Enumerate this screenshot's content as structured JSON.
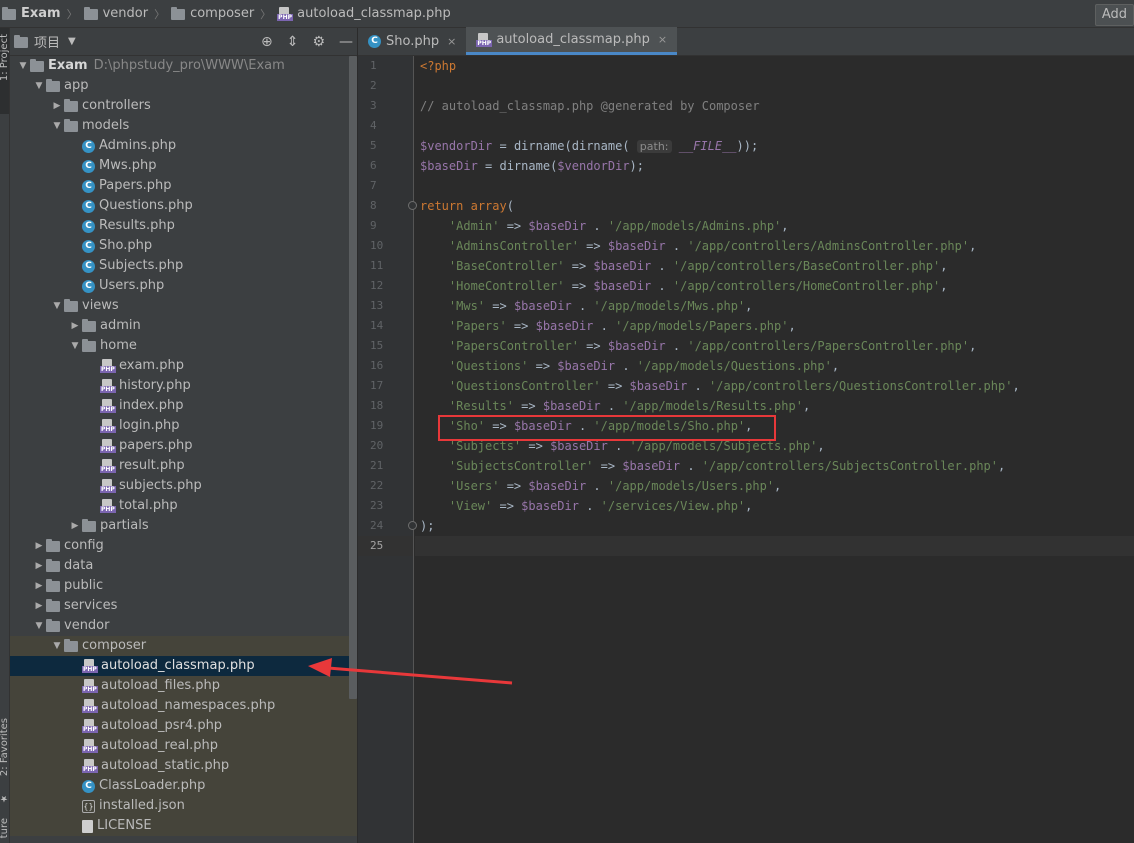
{
  "breadcrumb": {
    "project": "Exam",
    "items": [
      "vendor",
      "composer"
    ],
    "file": "autoload_classmap.php",
    "add_label": "Add"
  },
  "stripe": {
    "project_label": "1: Project",
    "favorites_label": "2: Favorites",
    "structure_label": "ture"
  },
  "project_panel": {
    "title": "项目",
    "root_name": "Exam",
    "root_path": "D:\\phpstudy_pro\\WWW\\Exam",
    "tree": [
      {
        "label": "app",
        "type": "folder"
      },
      {
        "label": "controllers",
        "type": "folder"
      },
      {
        "label": "models",
        "type": "folder"
      },
      {
        "label": "Admins.php",
        "type": "class"
      },
      {
        "label": "Mws.php",
        "type": "class"
      },
      {
        "label": "Papers.php",
        "type": "class"
      },
      {
        "label": "Questions.php",
        "type": "class"
      },
      {
        "label": "Results.php",
        "type": "class"
      },
      {
        "label": "Sho.php",
        "type": "class"
      },
      {
        "label": "Subjects.php",
        "type": "class"
      },
      {
        "label": "Users.php",
        "type": "class"
      },
      {
        "label": "views",
        "type": "folder"
      },
      {
        "label": "admin",
        "type": "folder"
      },
      {
        "label": "home",
        "type": "folder"
      },
      {
        "label": "exam.php",
        "type": "php"
      },
      {
        "label": "history.php",
        "type": "php"
      },
      {
        "label": "index.php",
        "type": "php"
      },
      {
        "label": "login.php",
        "type": "php"
      },
      {
        "label": "papers.php",
        "type": "php"
      },
      {
        "label": "result.php",
        "type": "php"
      },
      {
        "label": "subjects.php",
        "type": "php"
      },
      {
        "label": "total.php",
        "type": "php"
      },
      {
        "label": "partials",
        "type": "folder"
      },
      {
        "label": "config",
        "type": "folder"
      },
      {
        "label": "data",
        "type": "folder"
      },
      {
        "label": "public",
        "type": "folder"
      },
      {
        "label": "services",
        "type": "folder"
      },
      {
        "label": "vendor",
        "type": "folder"
      },
      {
        "label": "composer",
        "type": "folder"
      },
      {
        "label": "autoload_classmap.php",
        "type": "php"
      },
      {
        "label": "autoload_files.php",
        "type": "php"
      },
      {
        "label": "autoload_namespaces.php",
        "type": "php"
      },
      {
        "label": "autoload_psr4.php",
        "type": "php"
      },
      {
        "label": "autoload_real.php",
        "type": "php"
      },
      {
        "label": "autoload_static.php",
        "type": "php"
      },
      {
        "label": "ClassLoader.php",
        "type": "class"
      },
      {
        "label": "installed.json",
        "type": "json"
      },
      {
        "label": "LICENSE",
        "type": "text"
      }
    ]
  },
  "tabs": [
    {
      "label": "Sho.php",
      "active": false
    },
    {
      "label": "autoload_classmap.php",
      "active": true
    }
  ],
  "code": {
    "line_numbers": [
      "1",
      "2",
      "3",
      "4",
      "5",
      "6",
      "7",
      "8",
      "9",
      "10",
      "11",
      "12",
      "13",
      "14",
      "15",
      "16",
      "17",
      "18",
      "19",
      "20",
      "21",
      "22",
      "23",
      "24",
      "25"
    ],
    "open_tag": "<?php",
    "comment": "// autoload_classmap.php @generated by Composer",
    "vendor_var": "$vendorDir",
    "base_var": "$baseDir",
    "fn_dirname": "dirname",
    "hint_path": "path:",
    "file_const": "__FILE__",
    "kw_return": "return",
    "kw_array": "array",
    "entries": [
      {
        "key": "'Admin'",
        "path": "'/app/models/Admins.php'"
      },
      {
        "key": "'AdminsController'",
        "path": "'/app/controllers/AdminsController.php'"
      },
      {
        "key": "'BaseController'",
        "path": "'/app/controllers/BaseController.php'"
      },
      {
        "key": "'HomeController'",
        "path": "'/app/controllers/HomeController.php'"
      },
      {
        "key": "'Mws'",
        "path": "'/app/models/Mws.php'"
      },
      {
        "key": "'Papers'",
        "path": "'/app/models/Papers.php'"
      },
      {
        "key": "'PapersController'",
        "path": "'/app/controllers/PapersController.php'"
      },
      {
        "key": "'Questions'",
        "path": "'/app/models/Questions.php'"
      },
      {
        "key": "'QuestionsController'",
        "path": "'/app/controllers/QuestionsController.php'"
      },
      {
        "key": "'Results'",
        "path": "'/app/models/Results.php'"
      },
      {
        "key": "'Sho'",
        "path": "'/app/models/Sho.php'"
      },
      {
        "key": "'Subjects'",
        "path": "'/app/models/Subjects.php'"
      },
      {
        "key": "'SubjectsController'",
        "path": "'/app/controllers/SubjectsController.php'"
      },
      {
        "key": "'Users'",
        "path": "'/app/models/Users.php'"
      },
      {
        "key": "'View'",
        "path": "'/services/View.php'"
      }
    ],
    "close": ");"
  },
  "colors": {
    "highlight_box": "#e8383a",
    "annotation_arrow": "#e8383a"
  }
}
